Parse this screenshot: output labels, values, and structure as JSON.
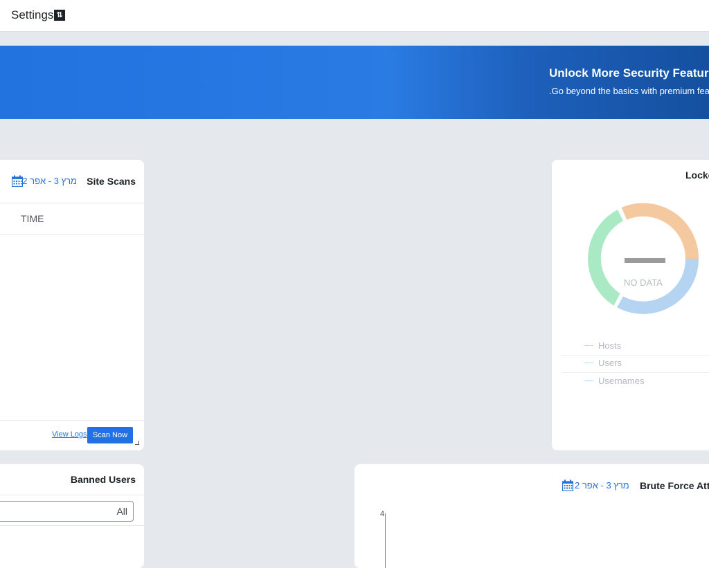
{
  "topbar": {
    "title": "Settings",
    "switch_icon": "⇅"
  },
  "banner": {
    "headline": "Unlock More Security Feature",
    "subtext": ".Go beyond the basics with premium fea"
  },
  "site_scans": {
    "title": "Site Scans",
    "date_range": "מרץ 3 - אפר 2",
    "columns": [
      "TIME"
    ],
    "view_logs": "View Logs",
    "scan_now": "Scan Now"
  },
  "lockouts": {
    "title": "Locko",
    "no_data": "NO DATA",
    "legend": [
      {
        "label": "Hosts",
        "color": "#f4c99f"
      },
      {
        "label": "Users",
        "color": "#a9eac5"
      },
      {
        "label": "Usernames",
        "color": "#b5d4f2"
      }
    ]
  },
  "banned_users": {
    "title": "Banned Users",
    "filter_value": "All"
  },
  "brute_force": {
    "title": "Brute Force Atta",
    "date_range": "מרץ 3 - אפר 2",
    "y_tick": "4"
  },
  "colors": {
    "accent": "#2271e3",
    "banner_dark": "#15509f"
  }
}
